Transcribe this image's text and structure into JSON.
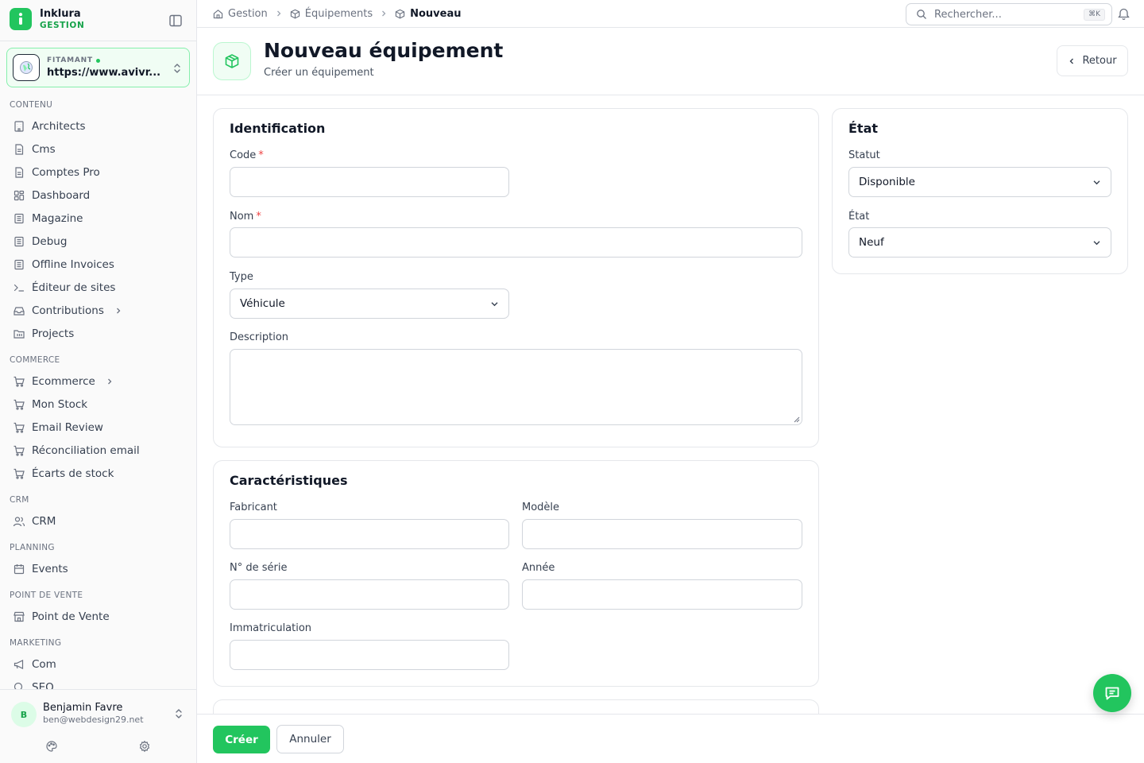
{
  "brand": {
    "name": "Inklura",
    "sub": "GESTION"
  },
  "site": {
    "label": "FITAMANT",
    "url": "https://www.avivr..."
  },
  "nav": {
    "contenu": "CONTENU",
    "items_contenu": [
      "Architects",
      "Cms",
      "Comptes Pro",
      "Dashboard",
      "Magazine",
      "Debug",
      "Offline Invoices",
      "Éditeur de sites",
      "Contributions",
      "Projects"
    ],
    "commerce": "COMMERCE",
    "items_commerce": [
      "Ecommerce",
      "Mon Stock",
      "Email Review",
      "Réconciliation email",
      "Écarts de stock"
    ],
    "crm": "CRM",
    "items_crm": [
      "CRM"
    ],
    "planning": "PLANNING",
    "items_planning": [
      "Events"
    ],
    "pdv": "POINT DE VENTE",
    "items_pdv": [
      "Point de Vente"
    ],
    "marketing": "MARKETING",
    "items_marketing": [
      "Com",
      "SEO"
    ]
  },
  "user": {
    "initial": "B",
    "name": "Benjamin Favre",
    "email": "ben@webdesign29.net"
  },
  "breadcrumb": [
    "Gestion",
    "Équipements",
    "Nouveau"
  ],
  "search": {
    "placeholder": "Rechercher...",
    "shortcut": "⌘K"
  },
  "header": {
    "title": "Nouveau équipement",
    "subtitle": "Créer un équipement",
    "back": "Retour"
  },
  "identification": {
    "title": "Identification",
    "code_label": "Code",
    "nom_label": "Nom",
    "type_label": "Type",
    "type_value": "Véhicule",
    "description_label": "Description",
    "required_mark": "*"
  },
  "caracteristiques": {
    "title": "Caractéristiques",
    "fabricant_label": "Fabricant",
    "modele_label": "Modèle",
    "serie_label": "N° de série",
    "annee_label": "Année",
    "immat_label": "Immatriculation"
  },
  "etat": {
    "title": "État",
    "statut_label": "Statut",
    "statut_value": "Disponible",
    "etat_label": "État",
    "etat_value": "Neuf"
  },
  "footer": {
    "create": "Créer",
    "cancel": "Annuler"
  },
  "colors": {
    "accent": "#22c55e",
    "required": "#ef4444"
  }
}
